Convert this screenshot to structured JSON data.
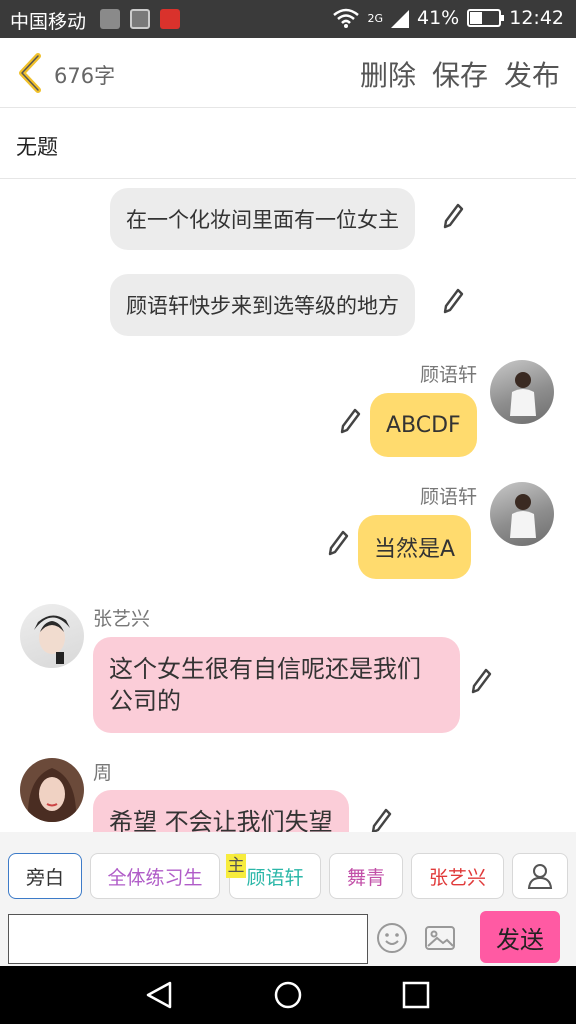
{
  "status_bar": {
    "carrier": "中国移动",
    "network": "2G",
    "battery": "41%",
    "battery_level": 0.41,
    "time": "12:42"
  },
  "header": {
    "word_count": "676字",
    "delete_label": "删除",
    "save_label": "保存",
    "publish_label": "发布"
  },
  "story": {
    "title": "无题"
  },
  "messages": [
    {
      "type": "narration",
      "text": "在一个化妆间里面有一位女主"
    },
    {
      "type": "narration",
      "text": "顾语轩快步来到选等级的地方"
    },
    {
      "type": "right",
      "sender": "顾语轩",
      "text": "ABCDF"
    },
    {
      "type": "right",
      "sender": "顾语轩",
      "text": "当然是A"
    },
    {
      "type": "left",
      "sender": "张艺兴",
      "text": "这个女生很有自信呢还是我们公司的"
    },
    {
      "type": "left",
      "sender": "周",
      "text": "希望 不会让我们失望"
    }
  ],
  "roles": [
    {
      "label": "旁白",
      "color": "#333333"
    },
    {
      "label": "全体练习生",
      "color": "#b05cc8"
    },
    {
      "label": "顾语轩",
      "color": "#2bb7a8",
      "badge": "主"
    },
    {
      "label": "舞青",
      "color": "#c250a8"
    },
    {
      "label": "张艺兴",
      "color": "#e03a3a"
    }
  ],
  "input": {
    "value": "",
    "send_label": "发送"
  },
  "colors": {
    "accent_pink": "#ff5aa3",
    "bubble_yellow": "#ffdb6e",
    "bubble_pink": "#fbcdd8",
    "bubble_grey": "#ececec"
  }
}
